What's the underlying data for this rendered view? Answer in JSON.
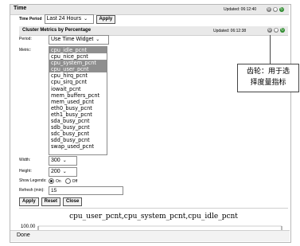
{
  "header": {
    "title": "Time",
    "updated": "Updated: 06:12:40"
  },
  "time_period": {
    "label": "Time Period",
    "value": "Last 24 Hours",
    "apply": "Apply"
  },
  "cluster": {
    "title": "Cluster Metrics by Percentage",
    "updated": "Updated: 06:12:38",
    "period_label": "Period:",
    "period_value": "Use Time Widget",
    "metric_label": "Metric:",
    "metrics": [
      {
        "label": "cpu_idle_pcnt",
        "selected": true
      },
      {
        "label": "cpu_nice_pcnt",
        "selected": false
      },
      {
        "label": "cpu_system_pcnt",
        "selected": true
      },
      {
        "label": "cpu_user_pcnt",
        "selected": true
      },
      {
        "label": "cpu_hirq_pcnt",
        "selected": false
      },
      {
        "label": "cpu_sirq_pcnt",
        "selected": false
      },
      {
        "label": "iowait_pcnt",
        "selected": false
      },
      {
        "label": "mem_buffers_pcnt",
        "selected": false
      },
      {
        "label": "mem_used_pcnt",
        "selected": false
      },
      {
        "label": "eth0_busy_pcnt",
        "selected": false
      },
      {
        "label": "eth1_busy_pcnt",
        "selected": false
      },
      {
        "label": "sda_busy_pcnt",
        "selected": false
      },
      {
        "label": "sdb_busy_pcnt",
        "selected": false
      },
      {
        "label": "sdc_busy_pcnt",
        "selected": false
      },
      {
        "label": "sdd_busy_pcnt",
        "selected": false
      },
      {
        "label": "swap_used_pcnt",
        "selected": false
      }
    ],
    "width_label": "Width:",
    "width_value": "300",
    "height_label": "Height:",
    "height_value": "200",
    "legends_label": "Show Legends:",
    "legend_on": "On",
    "legend_off": "Off",
    "legend_selected": "On",
    "refresh_label": "Refresh (min):",
    "refresh_value": "15",
    "buttons": {
      "apply": "Apply",
      "reset": "Reset",
      "close": "Close"
    },
    "chart_title": "cpu_user_pcnt,cpu_system_pcnt,cpu_idle_pcnt",
    "chart_first_tick": "100.00"
  },
  "status": {
    "text": "Done"
  },
  "callout": {
    "line1": "齿轮：用于选",
    "line2": "择度量指标"
  },
  "icons": [
    "gear-icon",
    "person-icon",
    "refresh-icon"
  ]
}
